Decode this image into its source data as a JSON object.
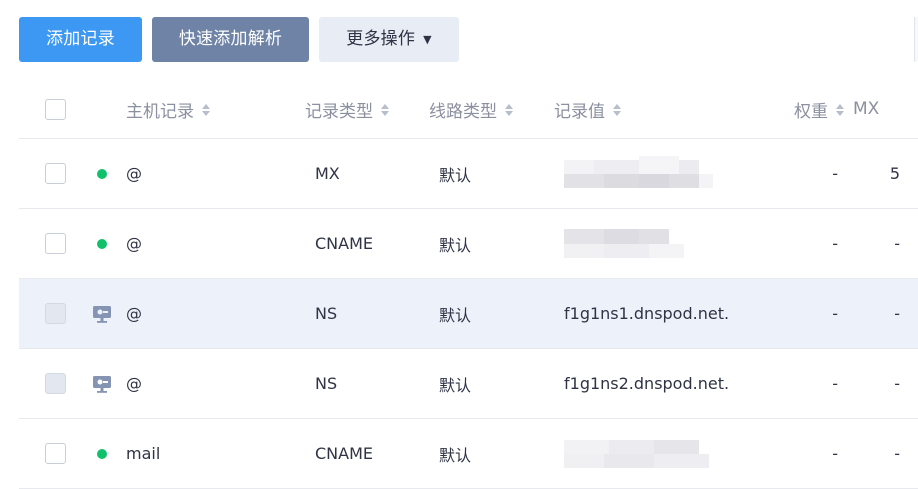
{
  "toolbar": {
    "add_label": "添加记录",
    "quick_add_label": "快速添加解析",
    "more_label": "更多操作"
  },
  "columns": {
    "host": "主机记录",
    "type": "记录类型",
    "line": "线路类型",
    "value": "记录值",
    "weight": "权重",
    "mx": "MX"
  },
  "rows": [
    {
      "status": "enabled",
      "host": "@",
      "type": "MX",
      "line": "默认",
      "value": "",
      "value_blurred": true,
      "weight": "-",
      "mx": "5"
    },
    {
      "status": "enabled",
      "host": "@",
      "type": "CNAME",
      "line": "默认",
      "value": "",
      "value_blurred": true,
      "weight": "-",
      "mx": "-"
    },
    {
      "status": "system",
      "host": "@",
      "type": "NS",
      "line": "默认",
      "value": "f1g1ns1.dnspod.net.",
      "value_blurred": false,
      "weight": "-",
      "mx": "-"
    },
    {
      "status": "system",
      "host": "@",
      "type": "NS",
      "line": "默认",
      "value": "f1g1ns2.dnspod.net.",
      "value_blurred": false,
      "weight": "-",
      "mx": "-"
    },
    {
      "status": "enabled",
      "host": "mail",
      "type": "CNAME",
      "line": "默认",
      "value": "",
      "value_blurred": true,
      "weight": "-",
      "mx": "-"
    }
  ],
  "colors": {
    "primary": "#3d98f3",
    "secondary": "#6e83a6",
    "status_enabled": "#11c06a",
    "row_highlight": "#edf2fa"
  }
}
